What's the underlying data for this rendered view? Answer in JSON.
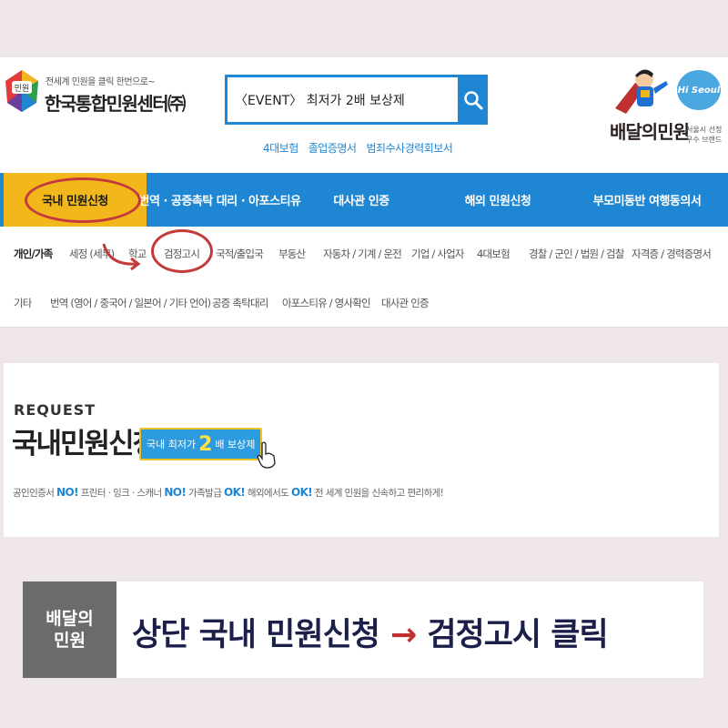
{
  "header": {
    "logo_badge": "민원",
    "logo_tagline": "전세계 민원을 클릭 한번으로~",
    "logo_name": "한국통합민원센터㈜",
    "search_value": "〈EVENT〉 최저가 2배 보상제",
    "quick_links": [
      "4대보험",
      "졸업증명서",
      "범죄수사경력회보서"
    ],
    "brand_name": "배달의민원",
    "brand_side": "서울시 선정 우수 브랜드",
    "brand_badge": "Hi Seoul"
  },
  "mainnav": {
    "items": [
      {
        "label": "국내 민원신청"
      },
      {
        "label": "번역 · 공증촉탁 대리 · 아포스티유"
      },
      {
        "label": "대사관 인증"
      },
      {
        "label": "해외 민원신청"
      },
      {
        "label": "부모미동반 여행동의서"
      }
    ]
  },
  "subnav": {
    "row1": [
      "개인/가족",
      "세정 (세무)",
      "학교",
      "검정고시",
      "국적/출입국",
      "부동산",
      "자동차 / 기계 / 운전",
      "기업 / 사업자",
      "4대보험",
      "경찰 / 군인 / 법원 / 검찰",
      "자격증 / 경력증명서"
    ],
    "row2": [
      "기타",
      "번역 (영어 / 중국어 / 일본어 / 기타 언어)",
      "공증 촉탁대리",
      "아포스티유 / 영사확인",
      "대사관 인증"
    ]
  },
  "request": {
    "eyebrow": "REQUEST",
    "title": "국내민원신청",
    "event_pre": "국내 최저가",
    "event_big": "2",
    "event_post": "배 보상제",
    "event_arrow": ">",
    "desc_1": "공인인증서 ",
    "desc_no1": "NO!",
    "desc_2": " 프린터 · 잉크 · 스캐너 ",
    "desc_no2": "NO!",
    "desc_3": " 가족발급 ",
    "desc_ok1": "OK!",
    "desc_4": " 해외에서도 ",
    "desc_ok2": "OK!",
    "desc_5": " 전 세계 민원을 신속하고 편리하게!"
  },
  "caption": {
    "badge": "배달의\n민원",
    "step1": "상단 국내 민원신청",
    "arrow": "→",
    "step2": "검정고시 클릭"
  },
  "colors": {
    "primary_blue": "#1f86d4",
    "active_yellow": "#f2b71a",
    "highlight_red": "#c33a3a",
    "caption_navy": "#1b1f4a"
  }
}
